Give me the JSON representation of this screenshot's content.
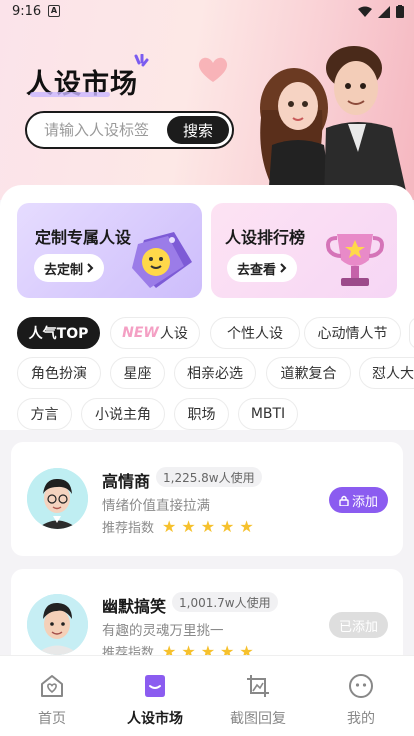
{
  "status_bar": {
    "time": "9:16",
    "notification_letter": "A"
  },
  "header": {
    "title": "人设市场",
    "search_placeholder": "请输入人设标签",
    "search_button": "搜索"
  },
  "promo_cards": [
    {
      "title": "定制专属人设",
      "button": "去定制"
    },
    {
      "title": "人设排行榜",
      "button": "去查看"
    }
  ],
  "tags": {
    "row1": [
      "人气TOP",
      "NEW",
      "人设",
      "个性人设",
      "心动情人节"
    ],
    "row2": [
      "角色扮演",
      "星座",
      "相亲必选",
      "道歉复合",
      "怼人大"
    ],
    "row3": [
      "方言",
      "小说主角",
      "职场",
      "MBTI"
    ]
  },
  "personas": [
    {
      "name": "高情商",
      "usage": "1,225.8w人使用",
      "description": "情绪价值直接拉满",
      "rating_label": "推荐指数",
      "rating": 5,
      "button": "添加",
      "added": false
    },
    {
      "name": "幽默搞笑",
      "usage": "1,001.7w人使用",
      "description": "有趣的灵魂万里挑一",
      "rating_label": "推荐指数",
      "rating": 5,
      "button": "已添加",
      "added": true
    }
  ],
  "nav": {
    "home": "首页",
    "market": "人设市场",
    "screenshot_reply": "截图回复",
    "mine": "我的"
  },
  "colors": {
    "accent_purple": "#8b5cf0",
    "star": "#f6c12d",
    "dark": "#1a1a1a"
  }
}
